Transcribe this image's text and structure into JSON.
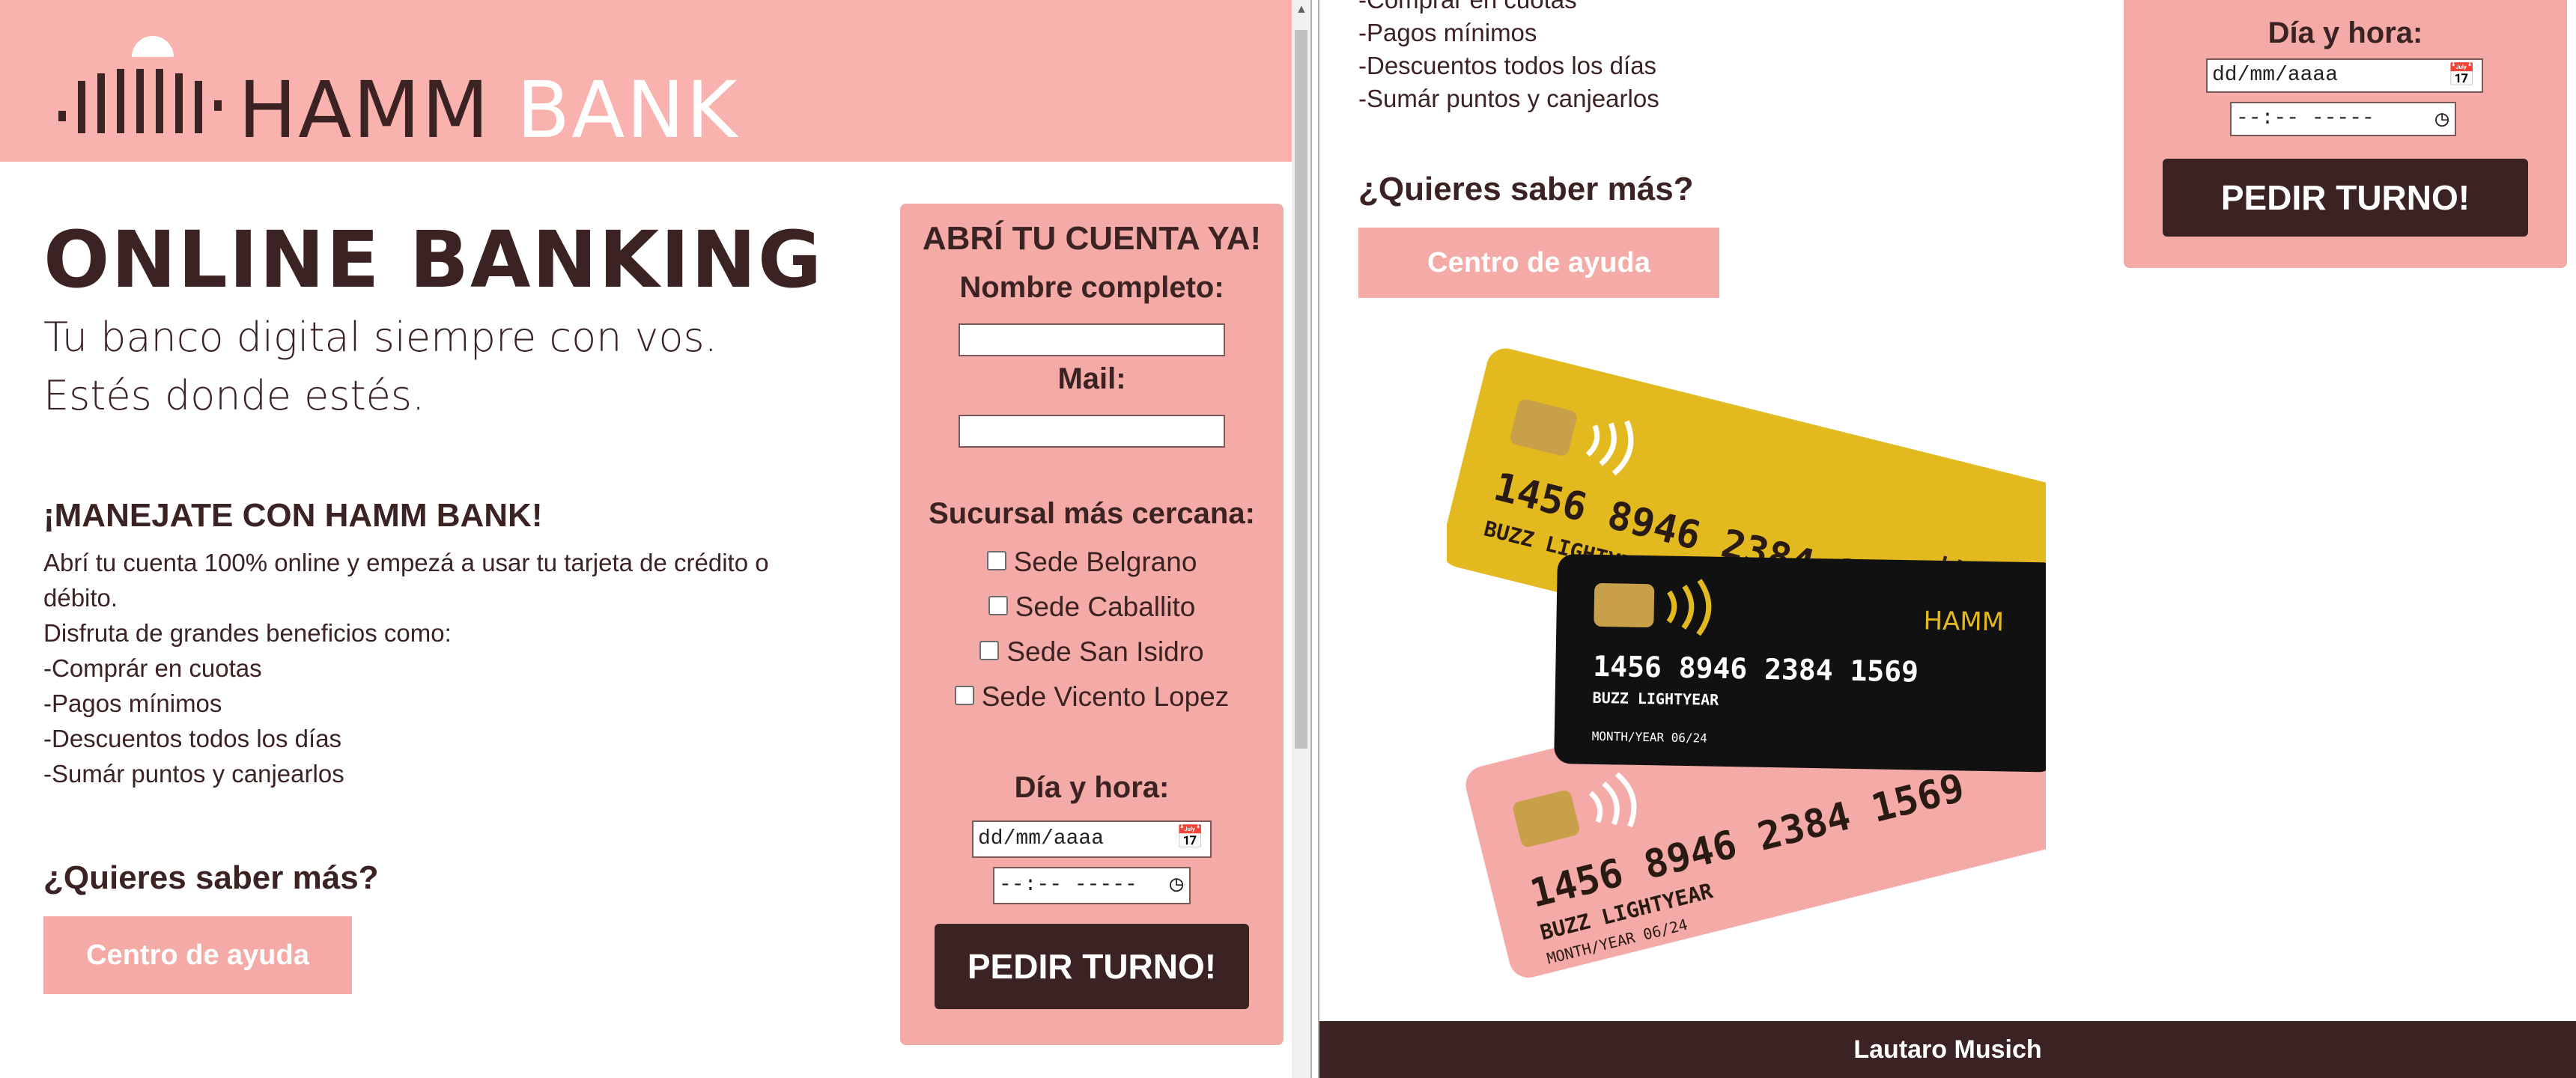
{
  "brand": {
    "name_dark": "HAMM",
    "name_light": "BANK"
  },
  "colors": {
    "header_bg": "#fab2ae",
    "form_bg": "#f4aaa6",
    "dark": "#3a2322",
    "white": "#ffffff",
    "card_gold": "#e2b91e",
    "card_black": "#111111",
    "card_pink": "#f4aaa6"
  },
  "hero": {
    "title": "ONLINE BANKING",
    "subtitle": "Tu banco digital siempre con vos. Estés donde estés."
  },
  "promo": {
    "title": "¡MANEJATE CON HAMM BANK!",
    "lines": [
      "Abrí tu cuenta 100% online y empezá a usar tu tarjeta de crédito o débito.",
      "Disfruta de grandes beneficios como:",
      "-Comprár en cuotas",
      "-Pagos mínimos",
      "-Descuentos todos los días",
      "-Sumár puntos y canjearlos"
    ]
  },
  "more": {
    "title": "¿Quieres saber más?",
    "help_button": "Centro de ayuda"
  },
  "form": {
    "title": "ABRÍ TU CUENTA YA!",
    "name_label": "Nombre completo:",
    "mail_label": "Mail:",
    "branch_label": "Sucursal más cercana:",
    "branches": [
      "Sede Belgrano",
      "Sede Caballito",
      "Sede San Isidro",
      "Sede Vicento Lopez"
    ],
    "datetime_label": "Día y hora:",
    "date_placeholder": "dd/mm/aaaa",
    "time_placeholder": "--:-- -----",
    "submit_label": "PEDIR TURNO!"
  },
  "right_window": {
    "body_lines": [
      "-Comprár en cuotas",
      "-Pagos mínimos",
      "-Descuentos todos los días",
      "-Sumár puntos y canjearlos"
    ],
    "more_title": "¿Quieres saber más?",
    "help_button": "Centro de ayuda",
    "datetime_label": "Día y hora:",
    "date_placeholder": "dd/mm/aaaa",
    "time_placeholder": "--:-- -----",
    "submit_label": "PEDIR TURNO!",
    "footer_text": "Lautaro Musich"
  },
  "cards": {
    "number": "1456 8946 2384 1569",
    "holder": "BUZZ LIGHTYEAR",
    "expiry": "MONTH/YEAR 06/24",
    "brand": "HAMM"
  },
  "icons": {
    "calendar": "calendar-icon",
    "clock": "clock-icon",
    "logo": "bank-logo-icon"
  }
}
